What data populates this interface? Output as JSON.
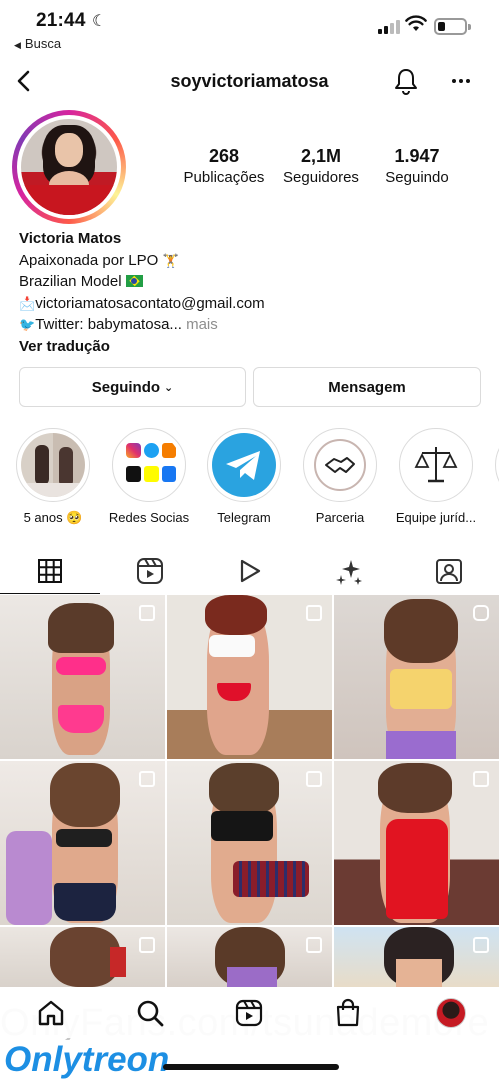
{
  "status_bar": {
    "time": "21:44",
    "back_app": "Busca",
    "icons": [
      "moon-icon",
      "cellular-signal-icon",
      "wifi-icon",
      "battery-icon"
    ]
  },
  "header": {
    "username": "soyvictoriamatosa",
    "icons": [
      "back-chevron-icon",
      "bell-icon",
      "more-dots-icon"
    ]
  },
  "profile": {
    "stats": [
      {
        "value": "268",
        "label": "Publicações"
      },
      {
        "value": "2,1M",
        "label": "Seguidores"
      },
      {
        "value": "1.947",
        "label": "Seguindo"
      }
    ],
    "name": "Victoria Matos",
    "bio": {
      "line1": "Apaixonada por LPO",
      "line2": "Brazilian Model",
      "line3": "victoriamatosacontato@gmail.com",
      "line4": "Twitter: babymatosa...",
      "more": "mais",
      "translate": "Ver tradução"
    }
  },
  "buttons": {
    "following": "Seguindo",
    "message": "Mensagem"
  },
  "highlights": [
    {
      "label": "5 anos 🥺"
    },
    {
      "label": "Redes Socias"
    },
    {
      "label": "Telegram"
    },
    {
      "label": "Parceria"
    },
    {
      "label": "Equipe juríd..."
    }
  ],
  "tabs": [
    "grid-icon",
    "reels-icon",
    "video-play-icon",
    "sparkles-icon",
    "tagged-person-icon"
  ],
  "bottom_nav": [
    "home-icon",
    "search-icon",
    "reels-icon",
    "shop-bag-icon",
    "profile-avatar-icon"
  ],
  "watermark": {
    "url": "OnlyFans.com/tsunademore",
    "logo_a": "Only",
    "logo_b": "treon"
  },
  "colors": {
    "link_blue": "#1d8fe3",
    "telegram": "#2aa3e0",
    "muted": "#8e8e8e",
    "border": "#dbdbdb"
  }
}
